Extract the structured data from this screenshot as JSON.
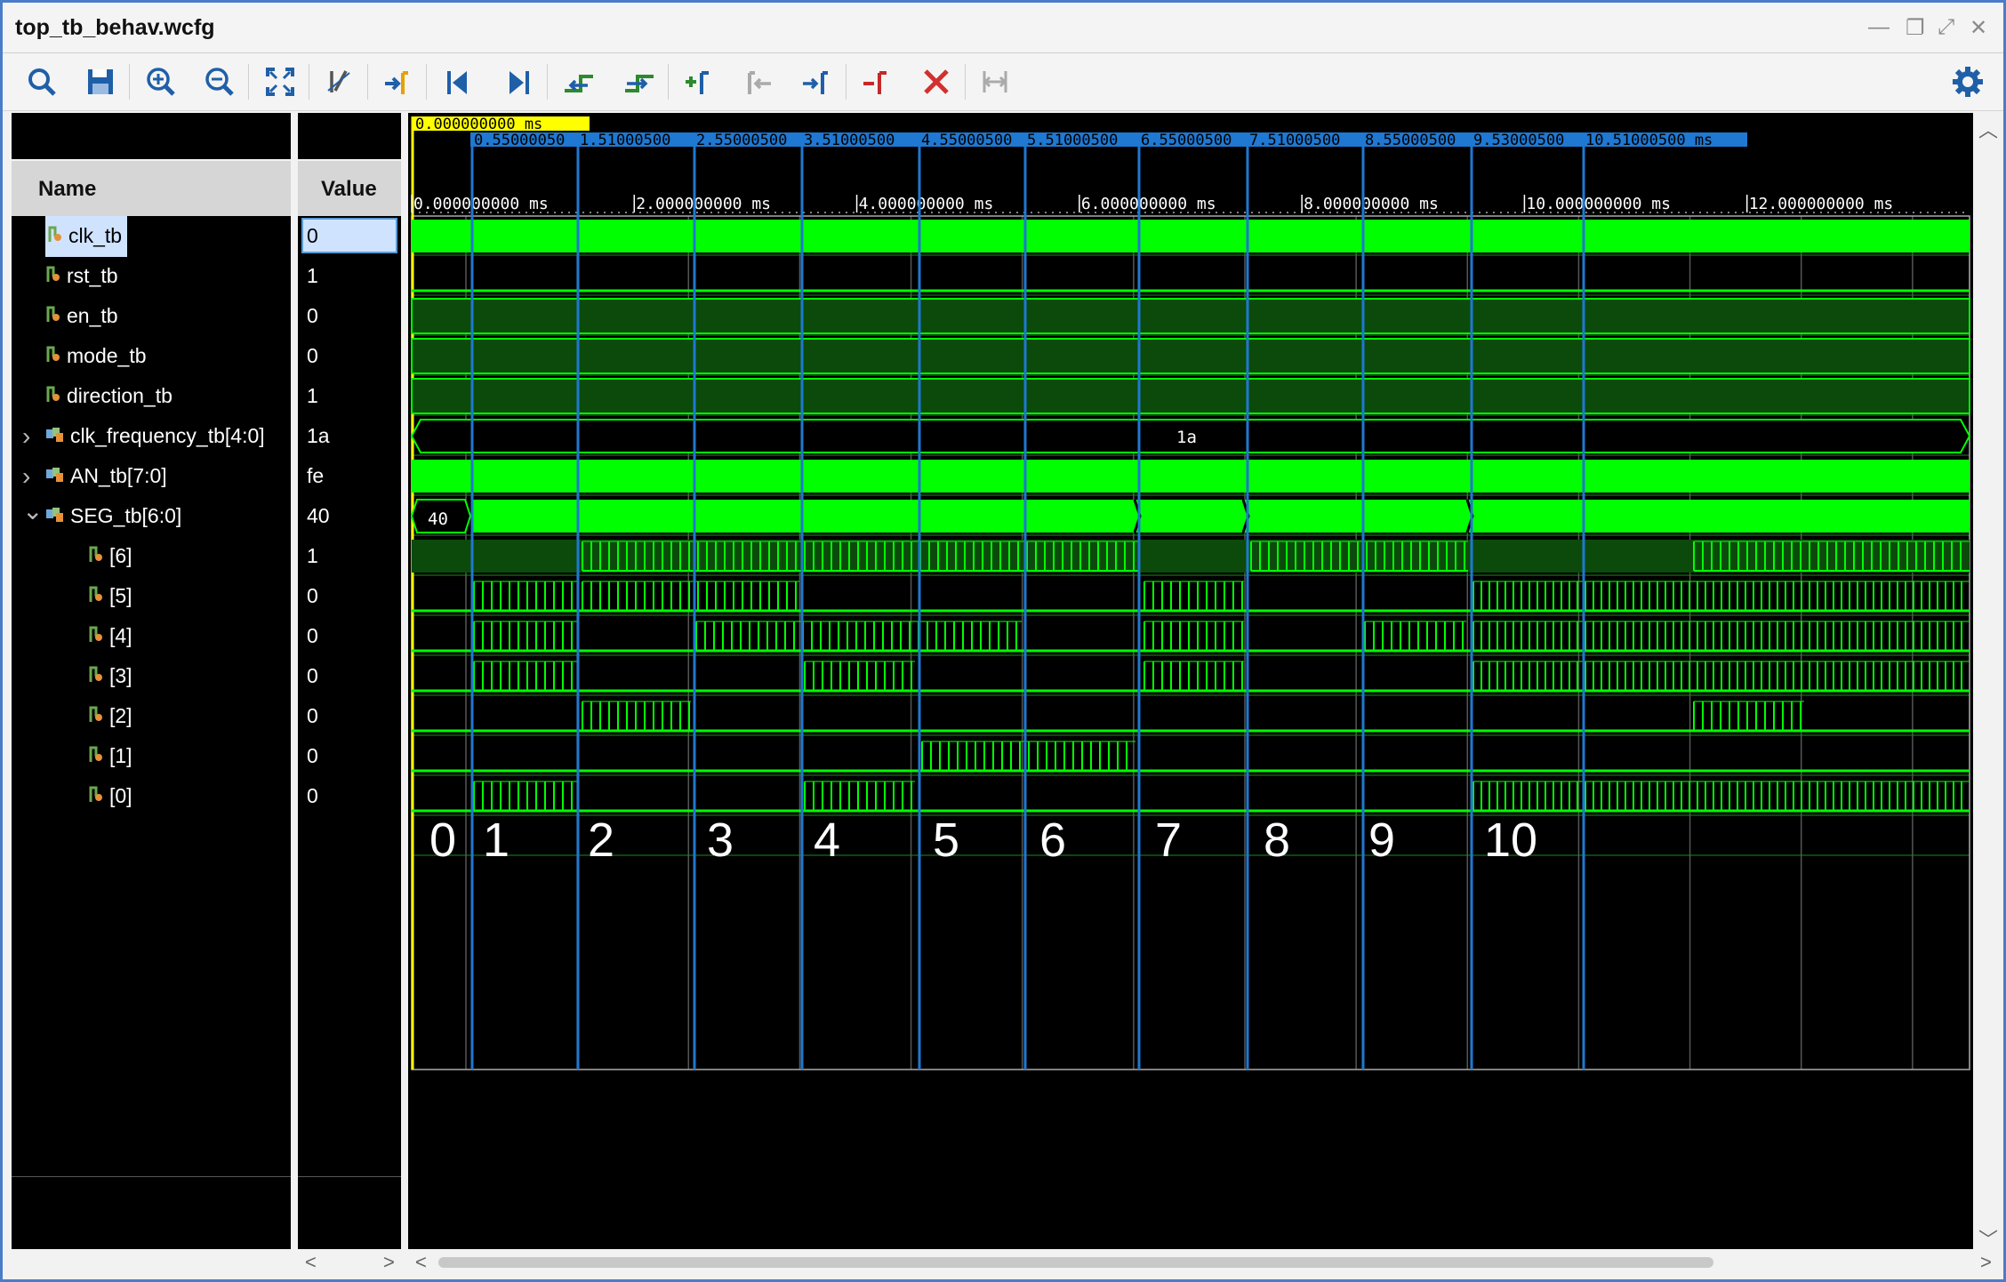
{
  "window": {
    "title": "top_tb_behav.wcfg"
  },
  "toolbar": {
    "buttons": [
      {
        "name": "search-button",
        "icon": "search-icon",
        "color": "#1f5fa8"
      },
      {
        "name": "save-button",
        "icon": "save-icon",
        "color": "#1f5fa8"
      },
      {
        "name": "zoom-in-button",
        "icon": "zoom-in-icon",
        "color": "#1f5fa8"
      },
      {
        "name": "zoom-out-button",
        "icon": "zoom-out-icon",
        "color": "#1f5fa8"
      },
      {
        "name": "zoom-fit-button",
        "icon": "zoom-fit-icon",
        "color": "#1f5fa8"
      },
      {
        "name": "snap-button",
        "icon": "cursor-snap-icon",
        "color": "#555"
      },
      {
        "name": "goto-cursor-button",
        "icon": "goto-cursor-icon",
        "color": "#1f5fa8"
      },
      {
        "name": "goto-start-button",
        "icon": "goto-start-icon",
        "color": "#1f5fa8"
      },
      {
        "name": "goto-end-button",
        "icon": "goto-end-icon",
        "color": "#1f5fa8"
      },
      {
        "name": "prev-transition-button",
        "icon": "prev-transition-icon",
        "color": "#2c8a2c"
      },
      {
        "name": "next-transition-button",
        "icon": "next-transition-icon",
        "color": "#2c8a2c"
      },
      {
        "name": "add-marker-button",
        "icon": "add-marker-icon",
        "color": "#2c8a2c"
      },
      {
        "name": "prev-marker-button",
        "icon": "prev-marker-icon",
        "color": "#aaa"
      },
      {
        "name": "next-marker-button",
        "icon": "next-marker-icon",
        "color": "#1f5fa8"
      },
      {
        "name": "delete-marker-button",
        "icon": "delete-marker-icon",
        "color": "#c62828"
      },
      {
        "name": "delete-all-markers-button",
        "icon": "delete-all-icon",
        "color": "#d32f2f"
      },
      {
        "name": "floating-ruler-button",
        "icon": "ruler-icon",
        "color": "#aaa"
      },
      {
        "name": "settings-button",
        "icon": "gear-icon",
        "color": "#1f5fa8"
      }
    ]
  },
  "columns": {
    "name": "Name",
    "value": "Value"
  },
  "signals": [
    {
      "name": "clk_tb",
      "value": "0",
      "type": "bit",
      "indent": 0,
      "expander": "",
      "selected": true
    },
    {
      "name": "rst_tb",
      "value": "1",
      "type": "bit",
      "indent": 0,
      "expander": ""
    },
    {
      "name": "en_tb",
      "value": "0",
      "type": "bit",
      "indent": 0,
      "expander": ""
    },
    {
      "name": "mode_tb",
      "value": "0",
      "type": "bit",
      "indent": 0,
      "expander": ""
    },
    {
      "name": "direction_tb",
      "value": "1",
      "type": "bit",
      "indent": 0,
      "expander": ""
    },
    {
      "name": "clk_frequency_tb[4:0]",
      "value": "1a",
      "type": "bus",
      "indent": 0,
      "expander": ">"
    },
    {
      "name": "AN_tb[7:0]",
      "value": "fe",
      "type": "bus",
      "indent": 0,
      "expander": ">"
    },
    {
      "name": "SEG_tb[6:0]",
      "value": "40",
      "type": "bus",
      "indent": 0,
      "expander": "v"
    },
    {
      "name": "[6]",
      "value": "1",
      "type": "bit",
      "indent": 1,
      "expander": ""
    },
    {
      "name": "[5]",
      "value": "0",
      "type": "bit",
      "indent": 1,
      "expander": ""
    },
    {
      "name": "[4]",
      "value": "0",
      "type": "bit",
      "indent": 1,
      "expander": ""
    },
    {
      "name": "[3]",
      "value": "0",
      "type": "bit",
      "indent": 1,
      "expander": ""
    },
    {
      "name": "[2]",
      "value": "0",
      "type": "bit",
      "indent": 1,
      "expander": ""
    },
    {
      "name": "[1]",
      "value": "0",
      "type": "bit",
      "indent": 1,
      "expander": ""
    },
    {
      "name": "[0]",
      "value": "0",
      "type": "bit",
      "indent": 1,
      "expander": ""
    }
  ],
  "waveform": {
    "cursor_label": "0.000000000 ms",
    "marker_labels": [
      "0.55000050",
      "1.51000500",
      "2.55000500",
      "3.51000500",
      "4.55000500",
      "5.51000500",
      "6.55000500",
      "7.51000500",
      "8.55000500",
      "9.53000500",
      "10.51000500 ms"
    ],
    "ruler_labels": [
      "0.000000000 ms",
      "2.000000000 ms",
      "4.000000000 ms",
      "6.000000000 ms",
      "8.000000000 ms",
      "10.000000000 ms",
      "12.000000000 ms"
    ],
    "bus_text": {
      "clk_frequency_tb": "1a",
      "SEG_tb": "40"
    },
    "digit_annotations": [
      "0",
      "1",
      "2",
      "3",
      "4",
      "5",
      "6",
      "7",
      "8",
      "9",
      "10"
    ],
    "colors": {
      "wave": "#00ff00",
      "wave_dark": "#0b4a0b",
      "marker": "#1f78d1",
      "cursor": "#ffff00",
      "grid": "#444",
      "background": "#000"
    }
  }
}
